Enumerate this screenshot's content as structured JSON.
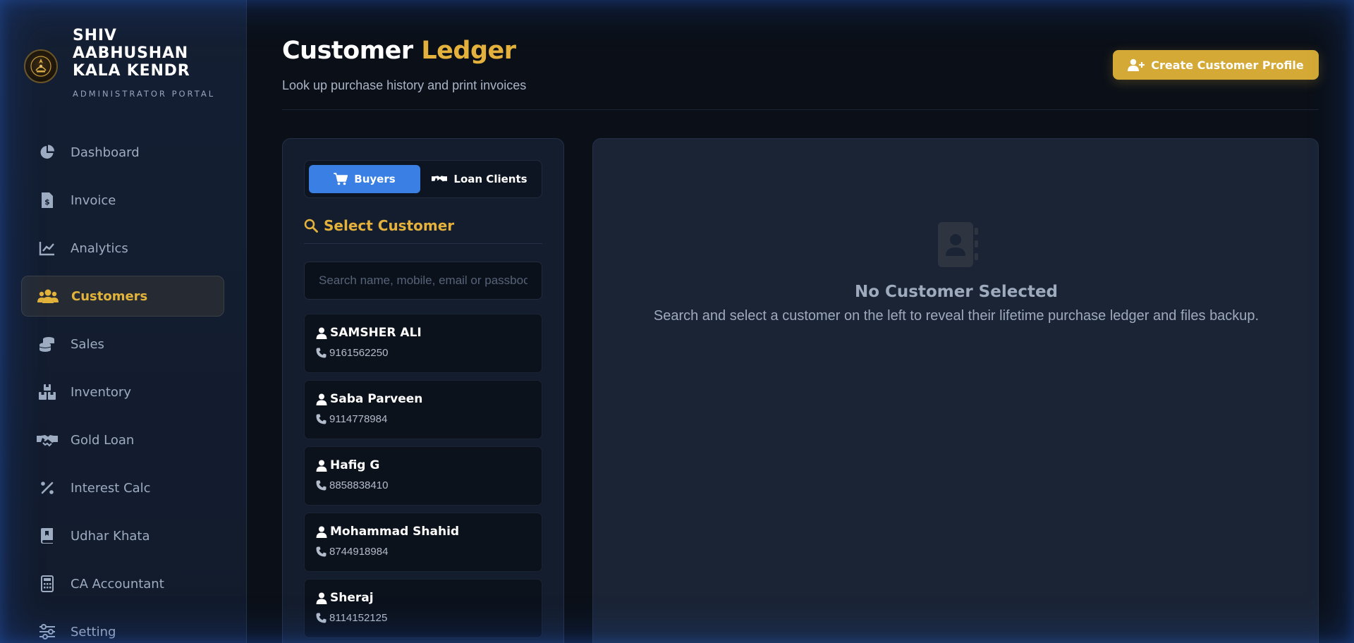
{
  "brand": {
    "name": "SHIV AABHUSHAN KALA KENDR",
    "subtitle": "ADMINISTRATOR PORTAL"
  },
  "nav": {
    "items": [
      {
        "label": "Dashboard",
        "icon": "pie-chart-icon"
      },
      {
        "label": "Invoice",
        "icon": "invoice-icon"
      },
      {
        "label": "Analytics",
        "icon": "line-chart-icon"
      },
      {
        "label": "Customers",
        "icon": "users-icon",
        "active": true
      },
      {
        "label": "Sales",
        "icon": "coins-icon"
      },
      {
        "label": "Inventory",
        "icon": "boxes-icon"
      },
      {
        "label": "Gold Loan",
        "icon": "handshake-icon"
      },
      {
        "label": "Interest Calc",
        "icon": "percent-icon"
      },
      {
        "label": "Udhar Khata",
        "icon": "book-icon"
      },
      {
        "label": "CA Accountant",
        "icon": "calculator-icon"
      },
      {
        "label": "Setting",
        "icon": "sliders-icon"
      }
    ]
  },
  "header": {
    "title_main": "Customer",
    "title_accent": "Ledger",
    "subtitle": "Look up purchase history and print invoices",
    "create_button": "Create Customer Profile"
  },
  "left_panel": {
    "tabs": {
      "buyers": "Buyers",
      "loan_clients": "Loan Clients"
    },
    "heading": "Select Customer",
    "search_placeholder": "Search name, mobile, email or passbook",
    "customers": [
      {
        "name": "SAMSHER ALI",
        "phone": "9161562250"
      },
      {
        "name": "Saba Parveen",
        "phone": "9114778984"
      },
      {
        "name": "Hafig G",
        "phone": "8858838410"
      },
      {
        "name": "Mohammad Shahid",
        "phone": "8744918984"
      },
      {
        "name": "Sheraj",
        "phone": "8114152125"
      }
    ]
  },
  "empty_state": {
    "title": "No Customer Selected",
    "description": "Search and select a customer on the left to reveal their lifetime purchase ledger and files backup.",
    "icon": "address-book-icon"
  },
  "colors": {
    "accent_gold": "#e4b13c",
    "primary_blue": "#3a7fe3",
    "bg": "#0b1018"
  }
}
